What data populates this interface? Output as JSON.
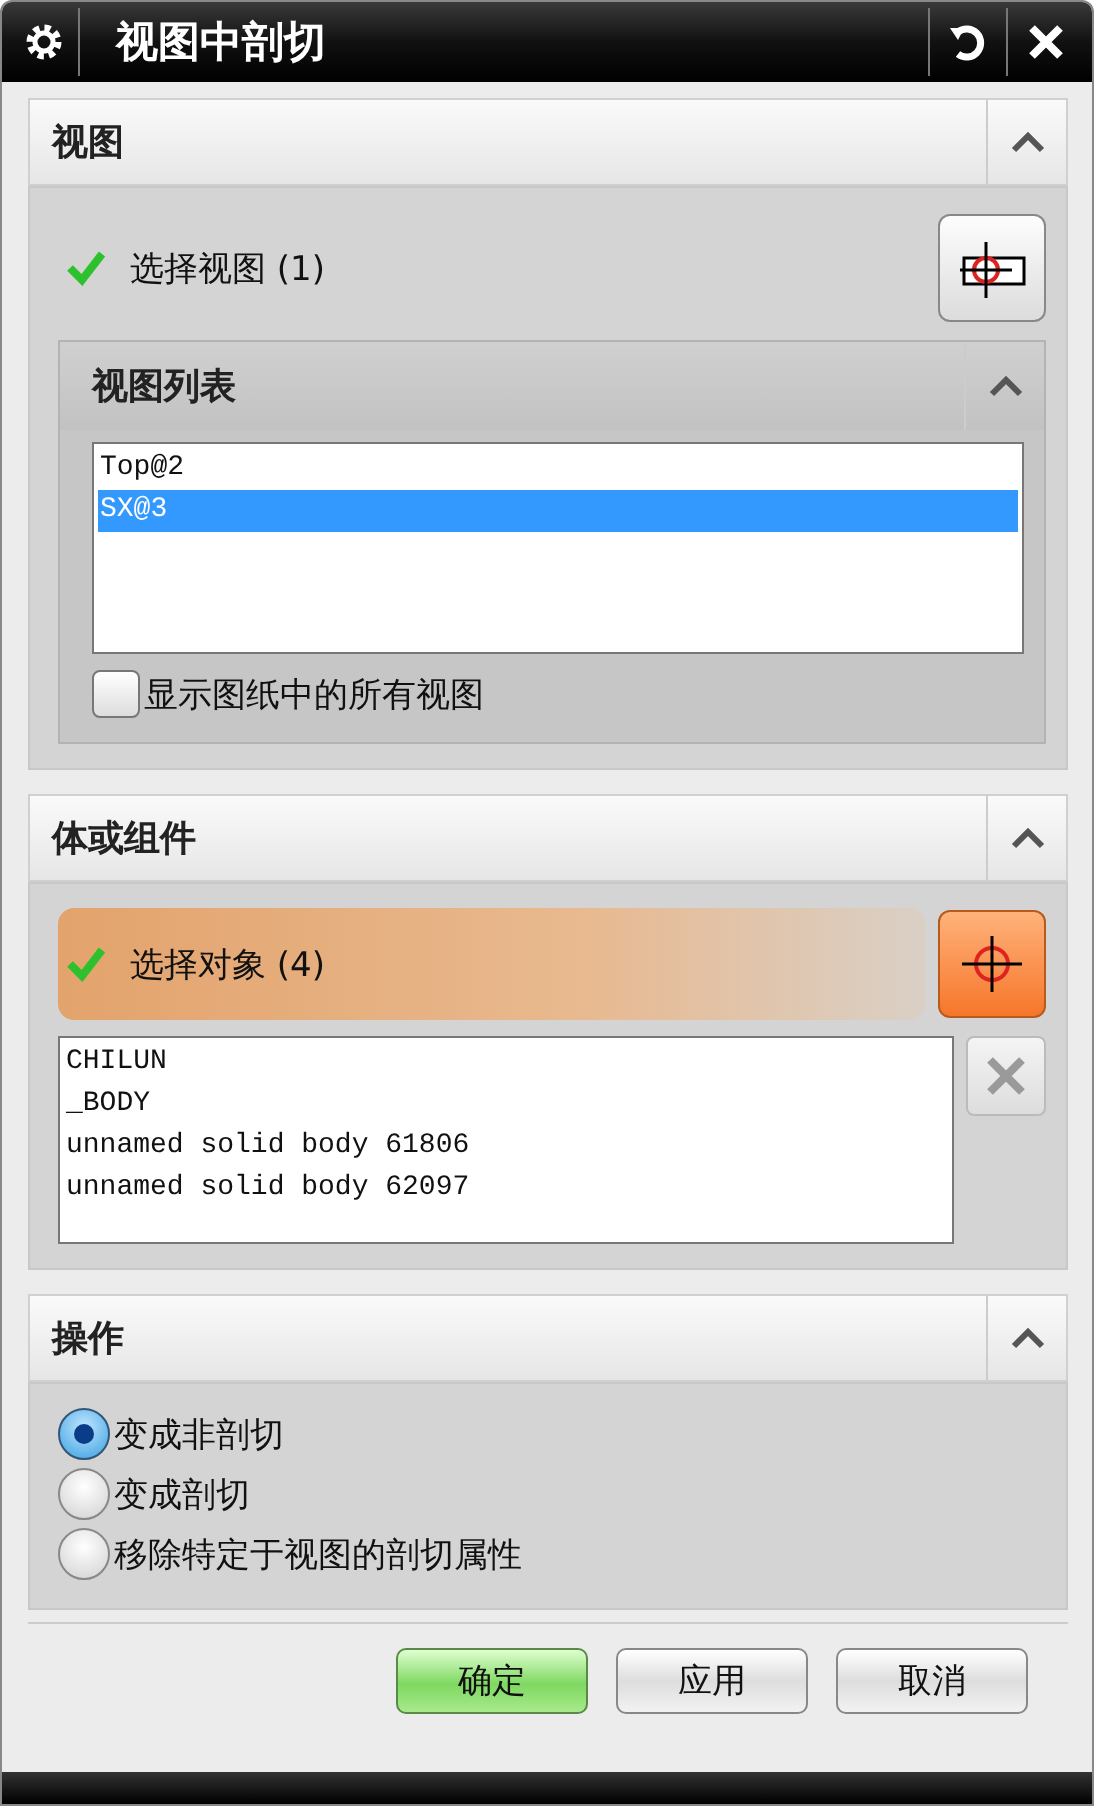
{
  "window": {
    "title": "视图中剖切"
  },
  "view_section": {
    "title": "视图",
    "expanded": true,
    "select": {
      "label": "选择视图 (1)",
      "done": true,
      "active": false
    },
    "view_list": {
      "title": "视图列表",
      "expanded": true,
      "items": [
        {
          "label": "Top@2",
          "selected": false
        },
        {
          "label": "SX@3",
          "selected": true
        }
      ]
    },
    "show_all": {
      "label": "显示图纸中的所有视图",
      "checked": false
    }
  },
  "body_section": {
    "title": "体或组件",
    "expanded": true,
    "select": {
      "label": "选择对象 (4)",
      "done": true,
      "active": true
    },
    "objects": [
      "CHILUN",
      "_BODY",
      "unnamed solid body 61806",
      "unnamed solid body 62097"
    ]
  },
  "operation_section": {
    "title": "操作",
    "expanded": true,
    "options": [
      {
        "label": "变成非剖切",
        "selected": true
      },
      {
        "label": "变成剖切",
        "selected": false
      },
      {
        "label": "移除特定于视图的剖切属性",
        "selected": false
      }
    ]
  },
  "buttons": [
    {
      "label": "确定",
      "default": true
    },
    {
      "label": "应用",
      "default": false
    },
    {
      "label": "取消",
      "default": false
    }
  ]
}
